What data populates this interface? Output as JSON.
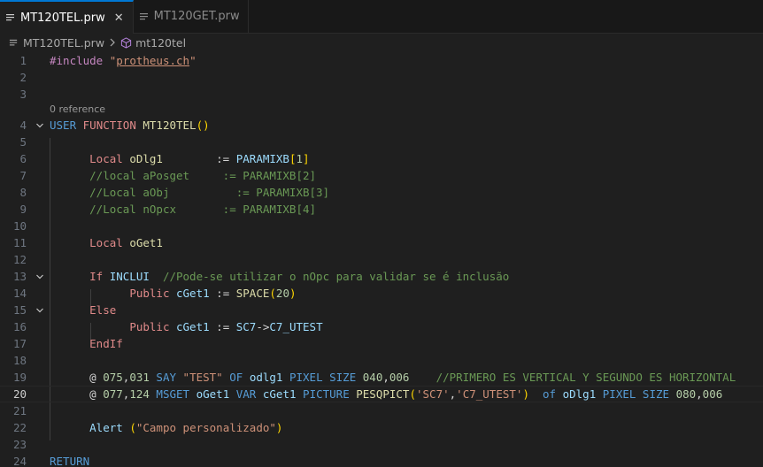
{
  "tabs": [
    {
      "label": "MT120TEL.prw",
      "active": true,
      "close": "✕"
    },
    {
      "label": "MT120GET.prw",
      "active": false
    }
  ],
  "breadcrumb": {
    "file": "MT120TEL.prw",
    "symbol": "mt120tel"
  },
  "codelens": "0 reference",
  "colors": {
    "accent": "#0078d4",
    "background": "#1f1f1f"
  },
  "lines": [
    {
      "n": "1",
      "fold": "",
      "tokens": [
        [
          "t-kw2",
          "#include "
        ],
        [
          "t-str",
          "\""
        ],
        [
          "t-str",
          "protheus.ch"
        ],
        [
          "t-str",
          "\""
        ]
      ]
    },
    {
      "n": "2",
      "fold": "",
      "tokens": []
    },
    {
      "n": "3",
      "fold": "",
      "tokens": []
    },
    {
      "n": "4",
      "fold": "v",
      "tokens": [
        [
          "t-kw",
          "USER "
        ],
        [
          "t-loc",
          "FUNCTION "
        ],
        [
          "t-fn",
          "MT120TEL"
        ],
        [
          "t-br",
          "()"
        ]
      ]
    },
    {
      "n": "5",
      "fold": "",
      "tokens": []
    },
    {
      "n": "6",
      "fold": "",
      "tokens": [
        [
          "t-pl",
          "      "
        ],
        [
          "t-loc",
          "Local "
        ],
        [
          "t-fn",
          "oDlg1"
        ],
        [
          "t-op",
          "        := "
        ],
        [
          "t-var",
          "PARAMIXB"
        ],
        [
          "t-br",
          "["
        ],
        [
          "t-num",
          "1"
        ],
        [
          "t-br",
          "]"
        ]
      ]
    },
    {
      "n": "7",
      "fold": "",
      "tokens": [
        [
          "t-pl",
          "      "
        ],
        [
          "t-com",
          "//local aPosget     := PARAMIXB[2]"
        ]
      ]
    },
    {
      "n": "8",
      "fold": "",
      "tokens": [
        [
          "t-pl",
          "      "
        ],
        [
          "t-com",
          "//Local aObj          := PARAMIXB[3]"
        ]
      ]
    },
    {
      "n": "9",
      "fold": "",
      "tokens": [
        [
          "t-pl",
          "      "
        ],
        [
          "t-com",
          "//Local nOpcx       := PARAMIXB[4]"
        ]
      ]
    },
    {
      "n": "10",
      "fold": "",
      "tokens": []
    },
    {
      "n": "11",
      "fold": "",
      "tokens": [
        [
          "t-pl",
          "      "
        ],
        [
          "t-loc",
          "Local "
        ],
        [
          "t-fn",
          "oGet1"
        ]
      ]
    },
    {
      "n": "12",
      "fold": "",
      "tokens": []
    },
    {
      "n": "13",
      "fold": "v",
      "tokens": [
        [
          "t-pl",
          "      "
        ],
        [
          "t-loc",
          "If "
        ],
        [
          "t-var",
          "INCLUI"
        ],
        [
          "t-pl",
          "  "
        ],
        [
          "t-com",
          "//Pode-se utilizar o nOpc para validar se é inclusão"
        ]
      ]
    },
    {
      "n": "14",
      "fold": "",
      "tokens": [
        [
          "t-pl",
          "            "
        ],
        [
          "t-loc",
          "Public "
        ],
        [
          "t-var",
          "cGet1"
        ],
        [
          "t-op",
          " := "
        ],
        [
          "t-fn",
          "SPACE"
        ],
        [
          "t-br",
          "("
        ],
        [
          "t-num",
          "20"
        ],
        [
          "t-br",
          ")"
        ]
      ]
    },
    {
      "n": "15",
      "fold": "v",
      "tokens": [
        [
          "t-pl",
          "      "
        ],
        [
          "t-loc",
          "Else"
        ]
      ]
    },
    {
      "n": "16",
      "fold": "",
      "tokens": [
        [
          "t-pl",
          "            "
        ],
        [
          "t-loc",
          "Public "
        ],
        [
          "t-var",
          "cGet1"
        ],
        [
          "t-op",
          " := "
        ],
        [
          "t-var",
          "SC7"
        ],
        [
          "t-op",
          "->"
        ],
        [
          "t-var",
          "C7_UTEST"
        ]
      ]
    },
    {
      "n": "17",
      "fold": "",
      "tokens": [
        [
          "t-pl",
          "      "
        ],
        [
          "t-loc",
          "EndIf"
        ]
      ]
    },
    {
      "n": "18",
      "fold": "",
      "tokens": []
    },
    {
      "n": "19",
      "fold": "",
      "tokens": [
        [
          "t-pl",
          "      "
        ],
        [
          "t-op",
          "@ "
        ],
        [
          "t-num",
          "075"
        ],
        [
          "t-op",
          ","
        ],
        [
          "t-num",
          "031"
        ],
        [
          "t-kw",
          " SAY "
        ],
        [
          "t-str",
          "\"TEST\""
        ],
        [
          "t-kw",
          " OF "
        ],
        [
          "t-var",
          "odlg1"
        ],
        [
          "t-kw",
          " PIXEL SIZE "
        ],
        [
          "t-num",
          "040"
        ],
        [
          "t-op",
          ","
        ],
        [
          "t-num",
          "006"
        ],
        [
          "t-pl",
          "    "
        ],
        [
          "t-com",
          "//PRIMERO ES VERTICAL Y SEGUNDO ES HORIZONTAL"
        ]
      ]
    },
    {
      "n": "20",
      "fold": "",
      "current": true,
      "tokens": [
        [
          "t-pl",
          "      "
        ],
        [
          "t-op",
          "@ "
        ],
        [
          "t-num",
          "077"
        ],
        [
          "t-op",
          ","
        ],
        [
          "t-num",
          "124"
        ],
        [
          "t-kw",
          " MSGET "
        ],
        [
          "t-var",
          "oGet1"
        ],
        [
          "t-kw",
          " VAR "
        ],
        [
          "t-var",
          "cGet1"
        ],
        [
          "t-kw",
          " PICTURE "
        ],
        [
          "t-fn",
          "PESQPICT"
        ],
        [
          "t-br",
          "("
        ],
        [
          "t-str",
          "'SC7'"
        ],
        [
          "t-op",
          ","
        ],
        [
          "t-str",
          "'C7_UTEST'"
        ],
        [
          "t-br",
          ")"
        ],
        [
          "t-pl",
          "  "
        ],
        [
          "t-kw",
          "of "
        ],
        [
          "t-var",
          "oDlg1"
        ],
        [
          "t-kw",
          " PIXEL SIZE "
        ],
        [
          "t-num",
          "080"
        ],
        [
          "t-op",
          ","
        ],
        [
          "t-num",
          "006"
        ]
      ]
    },
    {
      "n": "21",
      "fold": "",
      "tokens": []
    },
    {
      "n": "22",
      "fold": "",
      "tokens": [
        [
          "t-pl",
          "      "
        ],
        [
          "t-var",
          "Alert"
        ],
        [
          "t-pl",
          " "
        ],
        [
          "t-br",
          "("
        ],
        [
          "t-str",
          "\"Campo personalizado\""
        ],
        [
          "t-br",
          ")"
        ]
      ]
    },
    {
      "n": "23",
      "fold": "",
      "tokens": []
    },
    {
      "n": "24",
      "fold": "",
      "tokens": [
        [
          "t-kw",
          "RETURN"
        ]
      ]
    }
  ]
}
